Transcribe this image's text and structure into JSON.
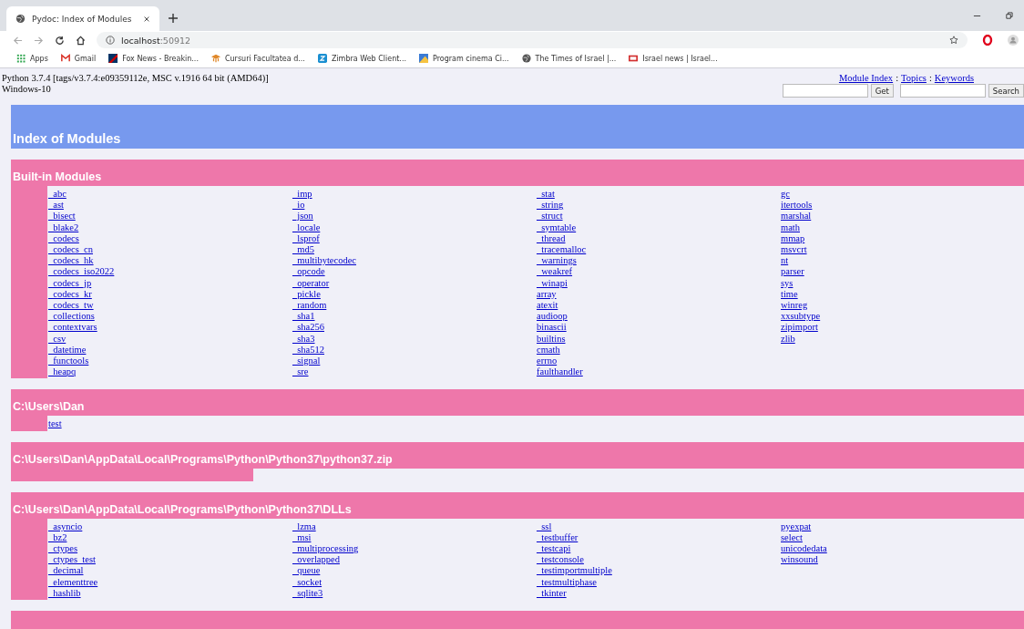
{
  "browser": {
    "tab": {
      "title": "Pydoc: Index of Modules",
      "selected": true
    },
    "address": {
      "host": "localhost",
      "port": ":50912"
    },
    "bookmarks": [
      {
        "kind": "apps",
        "label": "Apps"
      },
      {
        "kind": "mail",
        "label": "Gmail"
      },
      {
        "kind": "flag",
        "label": "Fox News - Breakin..."
      },
      {
        "kind": "hat",
        "label": "Cursuri Facultatea d..."
      },
      {
        "kind": "z",
        "label": "Zimbra Web Client..."
      },
      {
        "kind": "image",
        "label": "Program cinema Ci..."
      },
      {
        "kind": "globe",
        "label": "The Times of Israel |..."
      },
      {
        "kind": "news",
        "label": "Israel news | Israel..."
      }
    ]
  },
  "page": {
    "version": "Python 3.7.4 [tags/v3.7.4:e09359112e, MSC v.1916 64 bit (AMD64)]",
    "platform": "Windows-10",
    "nav": [
      "Module Index",
      "Topics",
      "Keywords"
    ],
    "nav_separator": ":",
    "get_button": "Get",
    "search_button": "Search",
    "title": "Index of Modules",
    "sections": [
      {
        "title": "Built-in Modules",
        "columns": [
          [
            "_abc",
            "_ast",
            "_bisect",
            "_blake2",
            "_codecs",
            "_codecs_cn",
            "_codecs_hk",
            "_codecs_iso2022",
            "_codecs_jp",
            "_codecs_kr",
            "_codecs_tw",
            "_collections",
            "_contextvars",
            "_csv",
            "_datetime",
            "_functools",
            "_heapq"
          ],
          [
            "_imp",
            "_io",
            "_json",
            "_locale",
            "_lsprof",
            "_md5",
            "_multibytecodec",
            "_opcode",
            "_operator",
            "_pickle",
            "_random",
            "_sha1",
            "_sha256",
            "_sha3",
            "_sha512",
            "_signal",
            "_sre"
          ],
          [
            "_stat",
            "_string",
            "_struct",
            "_symtable",
            "_thread",
            "_tracemalloc",
            "_warnings",
            "_weakref",
            "_winapi",
            "array",
            "atexit",
            "audioop",
            "binascii",
            "builtins",
            "cmath",
            "errno",
            "faulthandler"
          ],
          [
            "gc",
            "itertools",
            "marshal",
            "math",
            "mmap",
            "msvcrt",
            "nt",
            "parser",
            "sys",
            "time",
            "winreg",
            "xxsubtype",
            "zipimport",
            "zlib"
          ]
        ]
      },
      {
        "title": "C:\\Users\\Dan",
        "columns": [
          [
            "test"
          ]
        ]
      },
      {
        "title": "C:\\Users\\Dan\\AppData\\Local\\Programs\\Python\\Python37\\python37.zip"
      },
      {
        "title": "C:\\Users\\Dan\\AppData\\Local\\Programs\\Python\\Python37\\DLLs",
        "columns": [
          [
            "_asyncio",
            "_bz2",
            "_ctypes",
            "_ctypes_test",
            "_decimal",
            "_elementtree",
            "_hashlib"
          ],
          [
            "_lzma",
            "_msi",
            "_multiprocessing",
            "_overlapped",
            "_queue",
            "_socket",
            "_sqlite3"
          ],
          [
            "_ssl",
            "_testbuffer",
            "_testcapi",
            "_testconsole",
            "_testimportmultiple",
            "_testmultiphase",
            "_tkinter"
          ],
          [
            "pyexpat",
            "select",
            "unicodedata",
            "winsound"
          ]
        ]
      }
    ]
  }
}
